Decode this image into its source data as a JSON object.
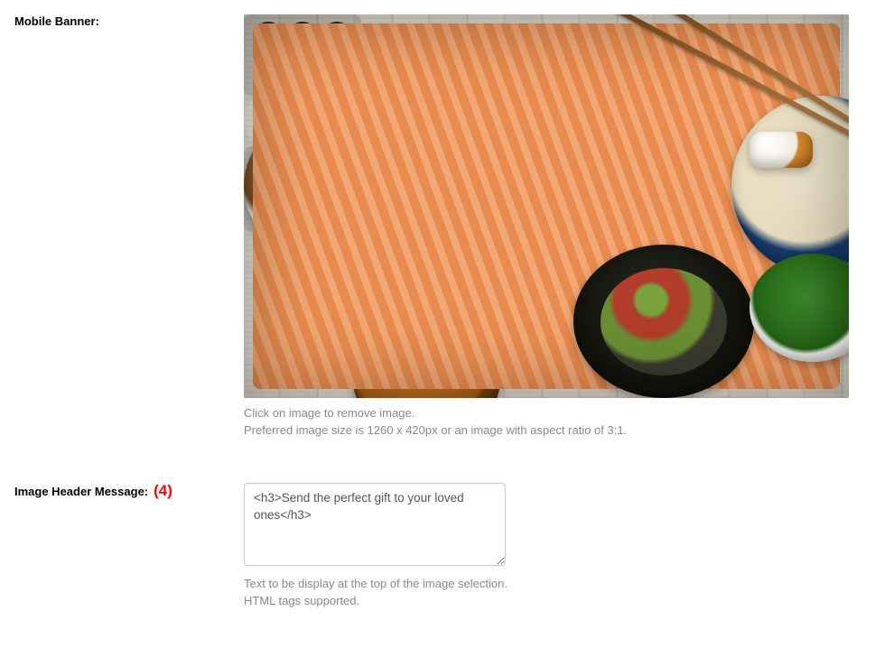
{
  "mobile_banner": {
    "label": "Mobile Banner:",
    "hint_line1": "Click on image to remove image.",
    "hint_line2": "Preferred image size is 1260 x 420px or an image with aspect ratio of 3:1."
  },
  "image_header_message": {
    "label": "Image Header Message:",
    "annotation": "(4)",
    "value": "<h3>Send the perfect gift to your loved ones</h3>",
    "hint_line1": "Text to be display at the top of the image selection.",
    "hint_line2": "HTML tags supported."
  }
}
